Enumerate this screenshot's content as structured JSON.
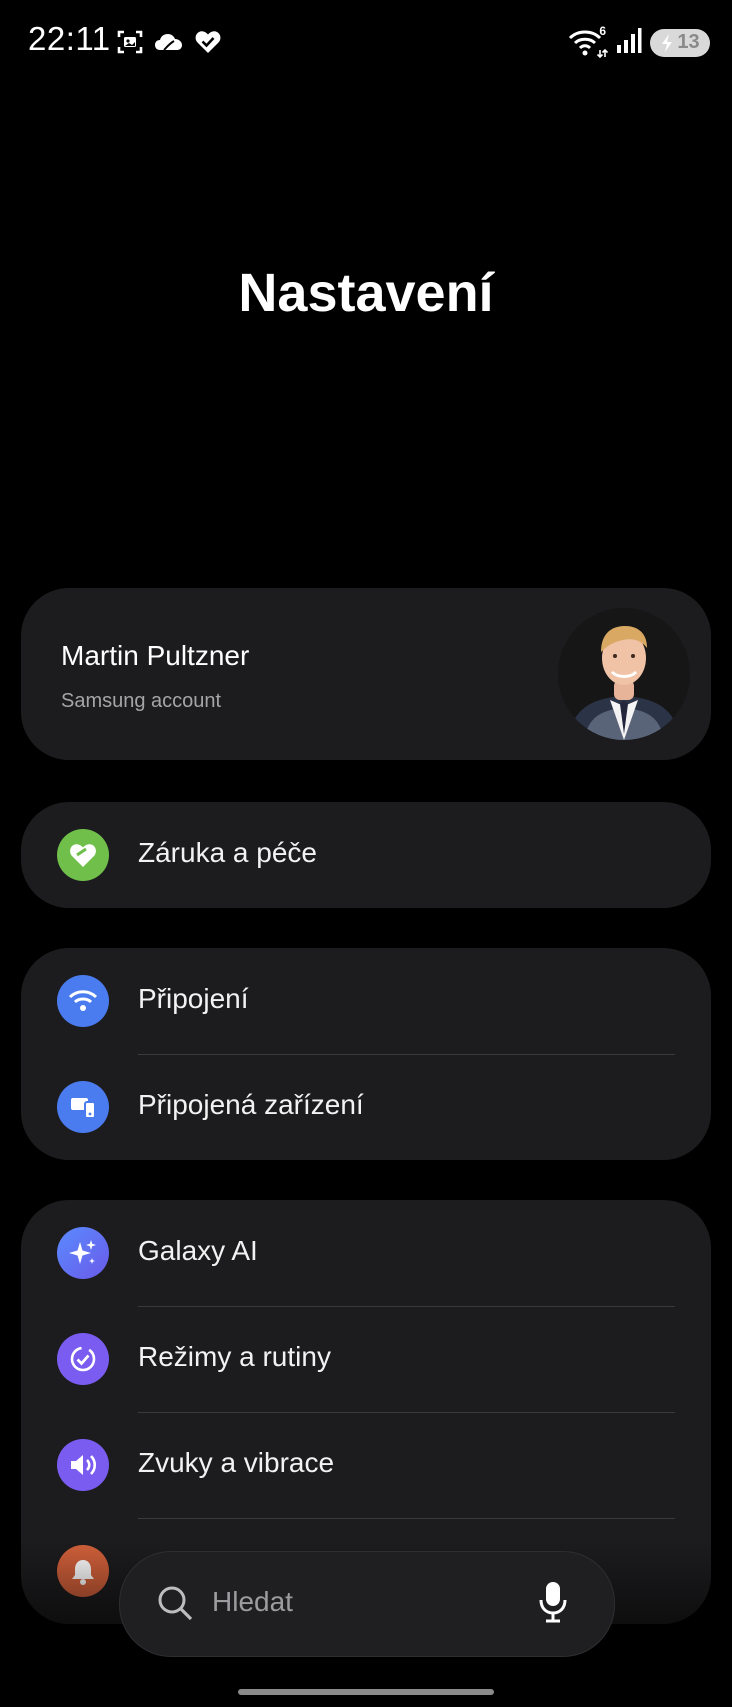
{
  "status_bar": {
    "time": "22:11",
    "wifi_badge": "6",
    "battery_level": "13",
    "left_icons": [
      "screenshot-icon",
      "cloud-icon",
      "heart-check-icon"
    ],
    "right_icons": [
      "wifi-icon",
      "signal-icon",
      "battery-icon"
    ]
  },
  "page": {
    "title": "Nastavení"
  },
  "account": {
    "name": "Martin Pultzner",
    "subtitle": "Samsung account"
  },
  "groups": [
    {
      "items": [
        {
          "label": "Záruka a péče",
          "icon": "heart-care-icon",
          "color": "#6fbf4a"
        }
      ]
    },
    {
      "items": [
        {
          "label": "Připojení",
          "icon": "wifi-icon",
          "color": "#4a7cf0"
        },
        {
          "label": "Připojená zařízení",
          "icon": "devices-icon",
          "color": "#4a7cf0"
        }
      ]
    },
    {
      "items": [
        {
          "label": "Galaxy AI",
          "icon": "sparkle-icon",
          "color": "#4a7cf0"
        },
        {
          "label": "Režimy a rutiny",
          "icon": "routine-icon",
          "color": "#7b5cf0"
        },
        {
          "label": "Zvuky a vibrace",
          "icon": "speaker-icon",
          "color": "#7b5cf0"
        },
        {
          "label": "",
          "icon": "bell-icon",
          "color": "#d1603a"
        }
      ]
    }
  ],
  "search": {
    "placeholder": "Hledat",
    "icon": "search-icon",
    "voice_icon": "mic-icon"
  }
}
